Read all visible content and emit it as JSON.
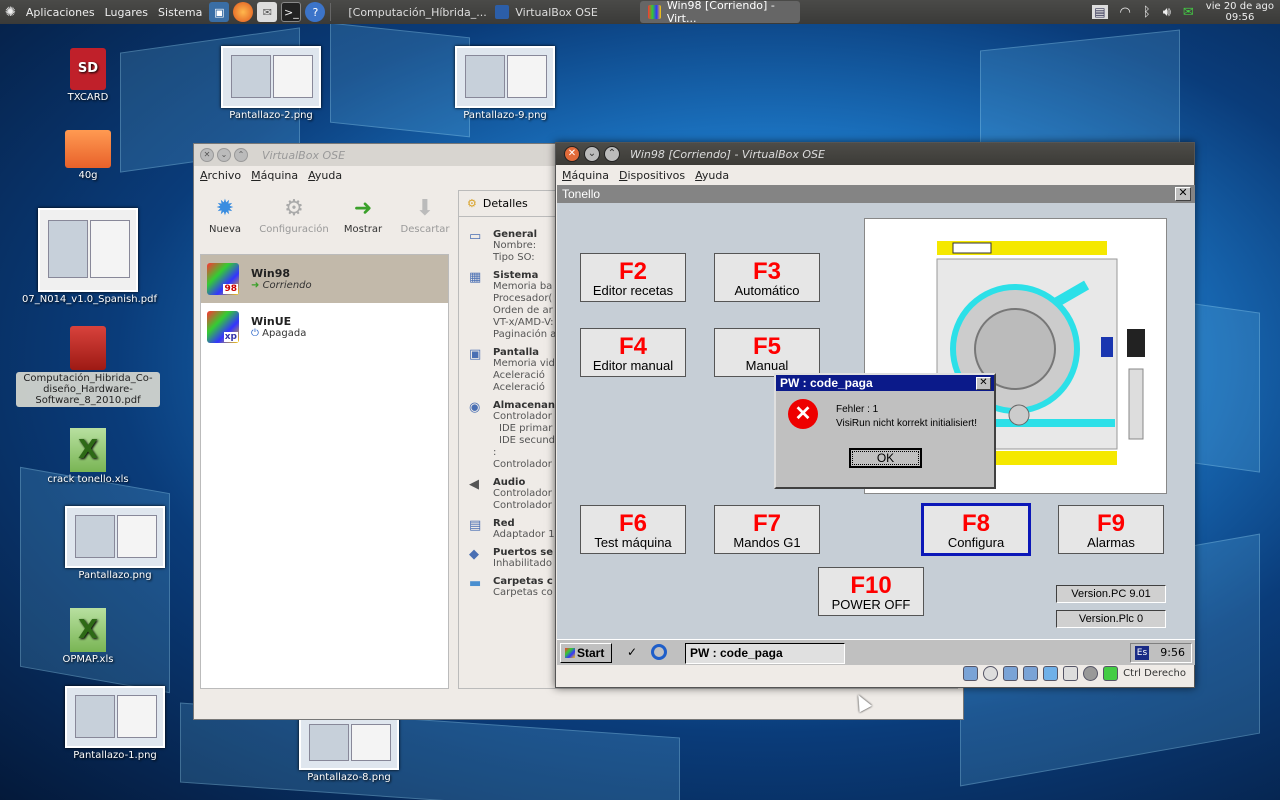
{
  "top_panel": {
    "menus": [
      "Aplicaciones",
      "Lugares",
      "Sistema"
    ],
    "tasks": [
      {
        "label": "[Computación_Híbrida_...",
        "active": false
      },
      {
        "label": "VirtualBox OSE",
        "active": false
      },
      {
        "label": "Win98 [Corriendo] - Virt...",
        "active": true
      }
    ],
    "clock_date": "vie 20 de ago",
    "clock_time": "09:56"
  },
  "desktop_icons": [
    {
      "label": "TXCARD",
      "icon": "sd-card-icon"
    },
    {
      "label": "40g",
      "icon": "folder-icon"
    },
    {
      "label": "07_N014_v1.0_Spanish.pdf",
      "icon": "pdf-document-icon"
    },
    {
      "label": "Computación_Hibrida_Co-diseño_Hardware-Software_8_2010.pdf",
      "icon": "pdf-icon"
    },
    {
      "label": "crack tonello.xls",
      "icon": "spreadsheet-icon"
    },
    {
      "label": "Pantallazo.png",
      "icon": "image-thumbnail"
    },
    {
      "label": "OPMAP.xls",
      "icon": "spreadsheet-icon"
    },
    {
      "label": "Pantallazo-1.png",
      "icon": "image-thumbnail"
    },
    {
      "label": "Pantallazo-2.png",
      "icon": "image-thumbnail"
    },
    {
      "label": "Pantallazo-9.png",
      "icon": "image-thumbnail"
    },
    {
      "label": "Pantallazo-8.png",
      "icon": "image-thumbnail"
    }
  ],
  "vbox_manager": {
    "title": "VirtualBox OSE",
    "menu": [
      "Archivo",
      "Máquina",
      "Ayuda"
    ],
    "toolbar": [
      {
        "label": "Nueva",
        "enabled": true
      },
      {
        "label": "Configuración",
        "enabled": false
      },
      {
        "label": "Mostrar",
        "enabled": true
      },
      {
        "label": "Descartar",
        "enabled": false
      }
    ],
    "vms": [
      {
        "name": "Win98",
        "state": "Corriendo",
        "logo": "98"
      },
      {
        "name": "WinUE",
        "state": "Apagada",
        "logo": "xp"
      }
    ],
    "details_tab": "Detalles",
    "details": [
      {
        "heading": "General",
        "lines": [
          "Nombre:",
          "Tipo SO:"
        ]
      },
      {
        "heading": "Sistema",
        "lines": [
          "Memoria ba",
          "Procesador(",
          "Orden de ar",
          "VT-x/AMD-V:",
          "Paginación a"
        ]
      },
      {
        "heading": "Pantalla",
        "lines": [
          "Memoria vid",
          "Aceleració",
          "Aceleració"
        ]
      },
      {
        "heading": "Almacenan",
        "lines": [
          "Controlador",
          "IDE primar",
          "IDE secund",
          ":",
          "Controlador"
        ]
      },
      {
        "heading": "Audio",
        "lines": [
          "Controlador",
          "Controlador"
        ]
      },
      {
        "heading": "Red",
        "lines": [
          "Adaptador 1"
        ]
      },
      {
        "heading": "Puertos se",
        "lines": [
          "Inhabilitado"
        ]
      },
      {
        "heading": "Carpetas c",
        "lines": [
          "Carpetas co"
        ]
      }
    ]
  },
  "vbox_vm": {
    "title": "Win98 [Corriendo] - VirtualBox OSE",
    "menu": [
      "Máquina",
      "Dispositivos",
      "Ayuda"
    ],
    "host_key": "Ctrl Derecho",
    "guest": {
      "app_title": "Tonello",
      "fkeys": [
        {
          "key": "F2",
          "label": "Editor recetas"
        },
        {
          "key": "F3",
          "label": "Automático"
        },
        {
          "key": "F4",
          "label": "Editor manual"
        },
        {
          "key": "F5",
          "label": "Manual"
        },
        {
          "key": "F6",
          "label": "Test máquina"
        },
        {
          "key": "F7",
          "label": "Mandos G1"
        },
        {
          "key": "F8",
          "label": "Configura"
        },
        {
          "key": "F9",
          "label": "Alarmas"
        },
        {
          "key": "F10",
          "label": "POWER OFF"
        }
      ],
      "version_pc": "Version.PC 9.01",
      "version_plc": "Version.Plc 0",
      "dialog": {
        "title": "PW : code_paga",
        "line1": "Fehler  :  1",
        "line2": "VisiRun nicht korrekt initialisiert!",
        "ok": "OK"
      },
      "taskbar": {
        "start": "Start",
        "task": "PW : code_paga",
        "lang": "Es",
        "time": "9:56"
      }
    }
  }
}
